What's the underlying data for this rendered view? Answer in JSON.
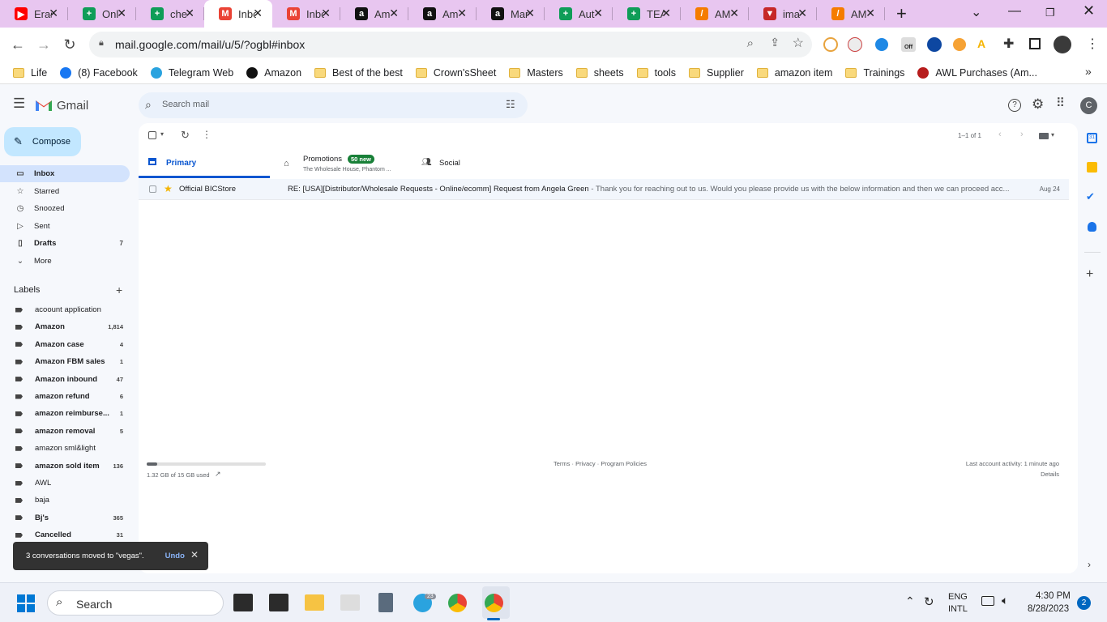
{
  "browser": {
    "tabs": [
      {
        "label": "Eras",
        "icon": "youtube-icon",
        "color": "#ff0000",
        "glyph": "▶"
      },
      {
        "label": "Onl",
        "icon": "sheets-icon",
        "color": "#0f9d58",
        "glyph": "+"
      },
      {
        "label": "che",
        "icon": "sheets-icon",
        "color": "#0f9d58",
        "glyph": "+"
      },
      {
        "label": "Inbo",
        "icon": "gmail-icon",
        "color": "#ea4335",
        "glyph": "M",
        "active": true
      },
      {
        "label": "Inbo",
        "icon": "gmail-icon",
        "color": "#ea4335",
        "glyph": "M"
      },
      {
        "label": "Am",
        "icon": "amazon-icon",
        "color": "#111111",
        "glyph": "a"
      },
      {
        "label": "Am",
        "icon": "amazon-icon",
        "color": "#111111",
        "glyph": "a"
      },
      {
        "label": "Mar",
        "icon": "amazon-icon",
        "color": "#111111",
        "glyph": "a"
      },
      {
        "label": "Aut",
        "icon": "sheets-icon",
        "color": "#0f9d58",
        "glyph": "+"
      },
      {
        "label": "TEA",
        "icon": "sheets-icon",
        "color": "#0f9d58",
        "glyph": "+"
      },
      {
        "label": "AM",
        "icon": "app-icon",
        "color": "#f57c00",
        "glyph": "/"
      },
      {
        "label": "ima",
        "icon": "app-icon",
        "color": "#c62828",
        "glyph": "▼"
      },
      {
        "label": "AM",
        "icon": "app-icon",
        "color": "#f57c00",
        "glyph": "/"
      }
    ],
    "url": "mail.google.com/mail/u/5/?ogbl#inbox",
    "bookmarks": [
      {
        "label": "Life",
        "icon": "folder-icon"
      },
      {
        "label": "(8) Facebook",
        "icon": "facebook-icon"
      },
      {
        "label": "Telegram Web",
        "icon": "telegram-icon"
      },
      {
        "label": "Amazon",
        "icon": "amazon-icon"
      },
      {
        "label": "Best of the best",
        "icon": "folder-icon"
      },
      {
        "label": "Crown'sSheet",
        "icon": "folder-icon"
      },
      {
        "label": "Masters",
        "icon": "folder-icon"
      },
      {
        "label": "sheets",
        "icon": "folder-icon"
      },
      {
        "label": "tools",
        "icon": "folder-icon"
      },
      {
        "label": "Supplier",
        "icon": "folder-icon"
      },
      {
        "label": "amazon item",
        "icon": "folder-icon"
      },
      {
        "label": "Trainings",
        "icon": "folder-icon"
      },
      {
        "label": "AWL Purchases (Am...",
        "icon": "awl-icon"
      }
    ]
  },
  "gmail": {
    "logo_text": "Gmail",
    "search_placeholder": "Search mail",
    "avatar_letter": "C",
    "compose_label": "Compose",
    "nav": [
      {
        "label": "Inbox",
        "icon": "inbox-icon",
        "count": "",
        "selected": true
      },
      {
        "label": "Starred",
        "icon": "star-icon",
        "count": ""
      },
      {
        "label": "Snoozed",
        "icon": "clock-icon",
        "count": ""
      },
      {
        "label": "Sent",
        "icon": "send-icon",
        "count": ""
      },
      {
        "label": "Drafts",
        "icon": "draft-icon",
        "count": "7",
        "bold": true
      },
      {
        "label": "More",
        "icon": "chevron-down-icon",
        "count": ""
      }
    ],
    "labels_title": "Labels",
    "labels": [
      {
        "label": "acoount application",
        "count": "",
        "bold": false
      },
      {
        "label": "Amazon",
        "count": "1,814",
        "bold": true
      },
      {
        "label": "Amazon case",
        "count": "4",
        "bold": true
      },
      {
        "label": "Amazon FBM sales",
        "count": "1",
        "bold": true
      },
      {
        "label": "Amazon inbound",
        "count": "47",
        "bold": true
      },
      {
        "label": "amazon refund",
        "count": "6",
        "bold": true
      },
      {
        "label": "amazon reimburse...",
        "count": "1",
        "bold": true
      },
      {
        "label": "amazon removal",
        "count": "5",
        "bold": true
      },
      {
        "label": "amazon sml&light",
        "count": "",
        "bold": false
      },
      {
        "label": "amazon sold item",
        "count": "136",
        "bold": true
      },
      {
        "label": "AWL",
        "count": "",
        "bold": false
      },
      {
        "label": "baja",
        "count": "",
        "bold": false
      },
      {
        "label": "Bj's",
        "count": "365",
        "bold": true
      },
      {
        "label": "Cancelled",
        "count": "31",
        "bold": true
      }
    ],
    "pagination": "1–1 of 1",
    "categories": {
      "primary": "Primary",
      "promotions": "Promotions",
      "promotions_badge": "50 new",
      "promotions_sub": "The Wholesale House, Phantom ...",
      "social": "Social"
    },
    "emails": [
      {
        "sender": "Official BICStore",
        "subject": "RE: [USA][Distributor/Wholesale Requests - Online/ecomm] Request from Angela Green",
        "snippet": " - Thank you for reaching out to us. Would you please provide us with the below information and then we can proceed acc...",
        "date": "Aug 24"
      }
    ],
    "storage_text": "1.32 GB of 15 GB used",
    "storage_fraction": 0.088,
    "footer_links": "Terms · Privacy · Program Policies",
    "activity": "Last account activity: 1 minute ago",
    "details": "Details",
    "toast_text": "3 conversations moved to \"vegas\".",
    "toast_undo": "Undo"
  },
  "taskbar": {
    "search_label": "Search",
    "telegram_badge": "23",
    "lang_top": "ENG",
    "lang_bottom": "INTL",
    "time": "4:30 PM",
    "date": "8/28/2023",
    "notification_count": "2"
  },
  "colors": {
    "gmail_red": "#ea4335",
    "compose_bg": "#c2e7ff",
    "selected_nav": "#d3e3fd",
    "primary_blue": "#0b57d0",
    "badge_green": "#188038",
    "tabstrip": "#e8c6f0"
  }
}
